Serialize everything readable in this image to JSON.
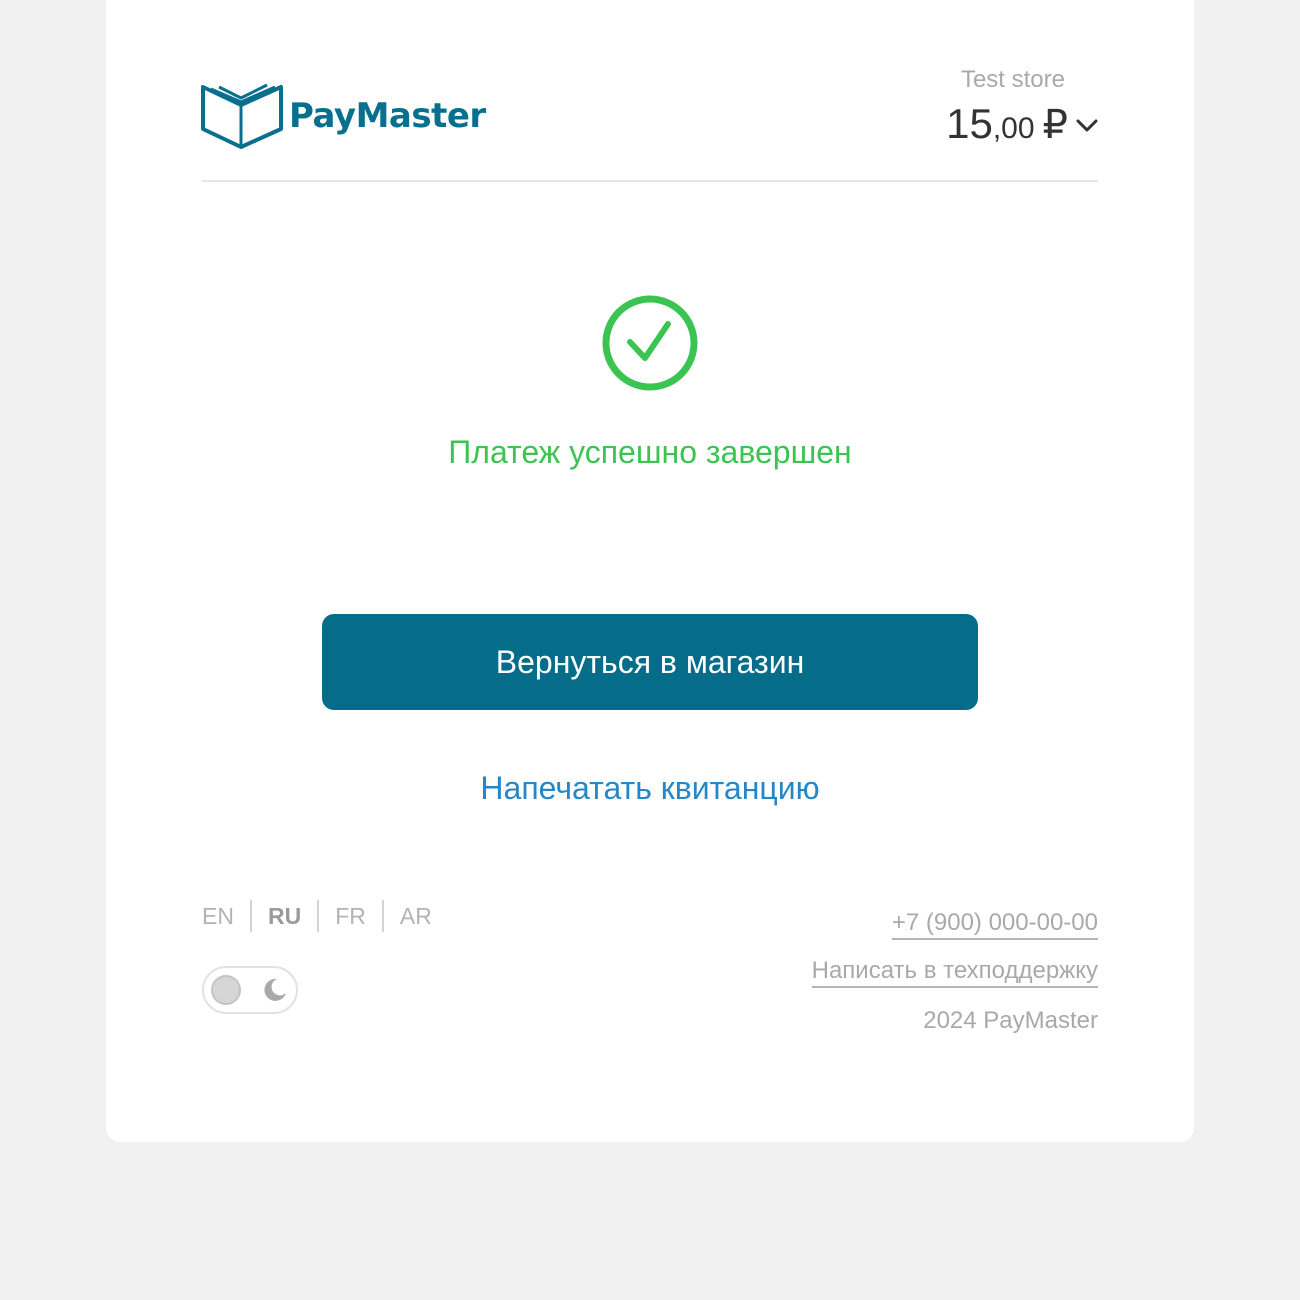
{
  "brand": {
    "name": "PayMaster",
    "color": "#08708e"
  },
  "header": {
    "store_name": "Test store",
    "amount_int": "15",
    "amount_frac": ",00",
    "currency": "₽"
  },
  "status": {
    "message": "Платеж успешно завершен",
    "color": "#3cc452",
    "icon": "check-circle-icon"
  },
  "actions": {
    "return_label": "Вернуться в магазин",
    "print_label": "Напечатать квитанцию",
    "button_color": "#056d8a",
    "link_color": "#2487c7"
  },
  "languages": {
    "items": [
      "EN",
      "RU",
      "FR",
      "AR"
    ],
    "active": "RU"
  },
  "theme_toggle": {
    "state": "light",
    "icon": "moon-icon"
  },
  "footer": {
    "phone": "+7 (900) 000-00-00",
    "support": "Написать в техподдержку",
    "copyright": "2024 PayMaster"
  }
}
